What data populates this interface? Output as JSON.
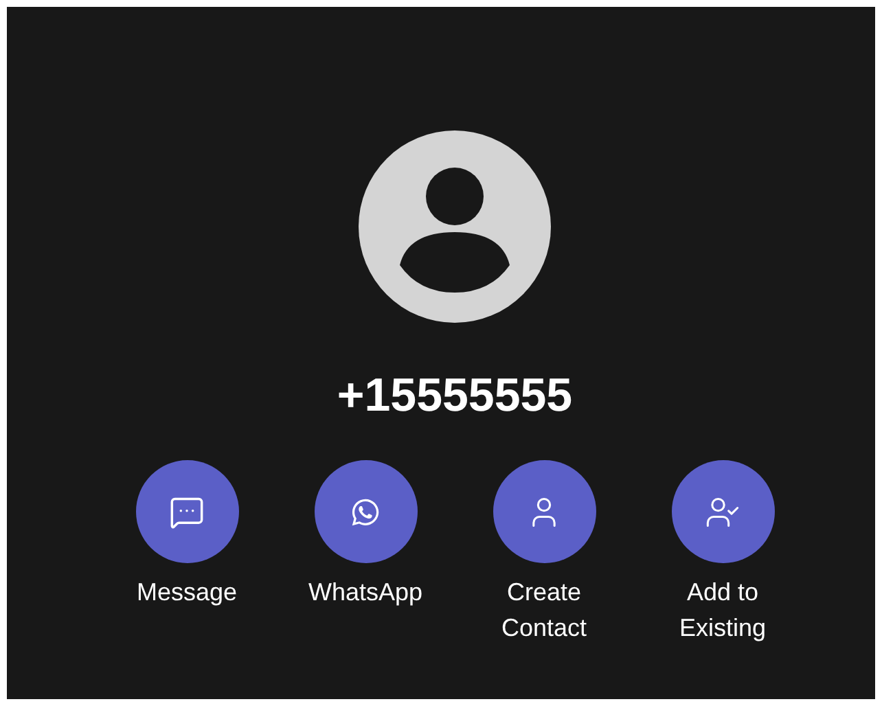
{
  "phone_number": "+15555555",
  "actions": [
    {
      "kind": "message",
      "label": "Message"
    },
    {
      "kind": "whatsapp",
      "label": "WhatsApp"
    },
    {
      "kind": "create",
      "label": "Create Contact"
    },
    {
      "kind": "add",
      "label": "Add to Existing"
    }
  ]
}
